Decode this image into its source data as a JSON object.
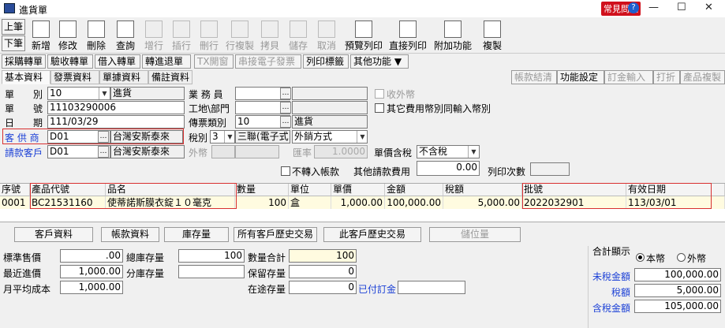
{
  "titlebar": {
    "title": "進貨單",
    "help": "常見問題",
    "help_q": "?",
    "min": "—",
    "max": "☐",
    "close": "✕"
  },
  "nav": {
    "prev": "上筆",
    "next": "下筆"
  },
  "toolbar": [
    {
      "label": "新增",
      "icon": "new-doc-icon",
      "enabled": true
    },
    {
      "label": "修改",
      "icon": "edit-icon",
      "enabled": true
    },
    {
      "label": "刪除",
      "icon": "delete-icon",
      "enabled": true
    },
    {
      "label": "查詢",
      "icon": "search-icon",
      "enabled": true
    },
    {
      "label": "增行",
      "icon": "add-row-icon",
      "enabled": false
    },
    {
      "label": "插行",
      "icon": "insert-row-icon",
      "enabled": false
    },
    {
      "label": "刪行",
      "icon": "delete-row-icon",
      "enabled": false
    },
    {
      "label": "行複製",
      "icon": "copy-row-icon",
      "enabled": false
    },
    {
      "label": "拷貝",
      "icon": "copy-icon",
      "enabled": false
    },
    {
      "label": "儲存",
      "icon": "save-icon",
      "enabled": false
    },
    {
      "label": "取消",
      "icon": "cancel-icon",
      "enabled": false
    },
    {
      "label": "預覽列印",
      "icon": "print-preview-icon",
      "enabled": true
    },
    {
      "label": "直接列印",
      "icon": "print-icon",
      "enabled": true
    },
    {
      "label": "附加功能",
      "icon": "addon-icon",
      "enabled": true
    },
    {
      "label": "複製",
      "icon": "duplicate-icon",
      "enabled": true
    }
  ],
  "row2": [
    {
      "label": "採購轉單",
      "enabled": true
    },
    {
      "label": "驗收轉單",
      "enabled": true
    },
    {
      "label": "借入轉單",
      "enabled": true
    },
    {
      "label": "轉進退單",
      "enabled": true
    },
    {
      "label": "TX開窗",
      "enabled": false
    },
    {
      "label": "串接電子發票",
      "enabled": false
    },
    {
      "label": "列印標籤",
      "enabled": true
    },
    {
      "label": "其他功能 ▼",
      "enabled": true
    }
  ],
  "tabs": [
    "基本資料",
    "發票資料",
    "單據資料",
    "備註資料"
  ],
  "right_tabs": [
    {
      "label": "帳款結清",
      "enabled": false
    },
    {
      "label": "功能設定",
      "enabled": true
    },
    {
      "label": "訂金輸入",
      "enabled": false
    },
    {
      "label": "打折",
      "enabled": false
    },
    {
      "label": "產品複製",
      "enabled": false
    }
  ],
  "form": {
    "type_label": "單　　別",
    "type_value": "10",
    "type_name": "進貨",
    "no_label": "單　　號",
    "no_value": "11103290006",
    "date_label": "日　　期",
    "date_value": "111/03/29",
    "supplier_label": "客 供 商",
    "supplier_code": "D01",
    "supplier_name": "台灣安斯泰來",
    "bill_label": "請款客戶",
    "bill_code": "D01",
    "bill_name": "台灣安斯泰來",
    "sales_label": "業 務 員",
    "sales_value": "",
    "site_label": "工地\\部門",
    "site_value": "",
    "voucher_label": "傳票類別",
    "voucher_code": "10",
    "voucher_name": "進貨",
    "tax_label": "稅別",
    "tax_value": "3",
    "tax_name": "三聯(電子式",
    "sale_mode": "外銷方式",
    "currency_label": "外幣",
    "rate_label": "匯率",
    "rate_value": "1.0000",
    "price_tax_label": "單價含稅",
    "price_tax_value": "不含稅",
    "no_transfer_label": "不轉入帳款",
    "other_fee_label": "其他請款費用",
    "other_fee_value": "0.00",
    "print_count_label": "列印次數",
    "print_count_value": "",
    "external_label": "收外幣",
    "other_currency_label": "其它費用幣別同輸入幣別"
  },
  "grid": {
    "headers": [
      "序號",
      "產品代號",
      "品名",
      "數量",
      "單位",
      "單價",
      "金額",
      "稅額",
      "批號",
      "有效日期"
    ],
    "rows": [
      {
        "seq": "0001",
        "code": "BC21531160",
        "name": "使蒂諾斯膜衣錠１０毫克",
        "qty": "100",
        "unit": "盒",
        "price": "1,000.00",
        "amount": "100,000.00",
        "tax": "5,000.00",
        "lot": "2022032901",
        "expiry": "113/03/01"
      }
    ]
  },
  "bottom_buttons": [
    {
      "label": "客戶資料",
      "enabled": true
    },
    {
      "label": "帳款資料",
      "enabled": true
    },
    {
      "label": "庫存量",
      "enabled": true
    },
    {
      "label": "所有客戶歷史交易",
      "enabled": true
    },
    {
      "label": "此客戶歷史交易",
      "enabled": true
    },
    {
      "label": "儲位量",
      "enabled": false
    }
  ],
  "bottom": {
    "std_price_label": "標準售價",
    "std_price": ".00",
    "recent_label": "最近進價",
    "recent": "1,000.00",
    "avg_label": "月平均成本",
    "avg": "1,000.00",
    "total_stock_label": "總庫存量",
    "total_stock": "100",
    "branch_stock_label": "分庫存量",
    "branch_stock": "",
    "qty_total_label": "數量合計",
    "qty_total": "100",
    "reserved_label": "保留存量",
    "reserved": "0",
    "transit_label": "在途存量",
    "transit": "0",
    "paid_deposit_label": "已付訂金",
    "paid_deposit": ""
  },
  "summary": {
    "title": "合計顯示",
    "opt_local": "本幣",
    "opt_foreign": "外幣",
    "pretax_label": "未稅金額",
    "pretax": "100,000.00",
    "tax_label": "稅額",
    "tax": "5,000.00",
    "total_label": "含稅金額",
    "total": "105,000.00"
  }
}
